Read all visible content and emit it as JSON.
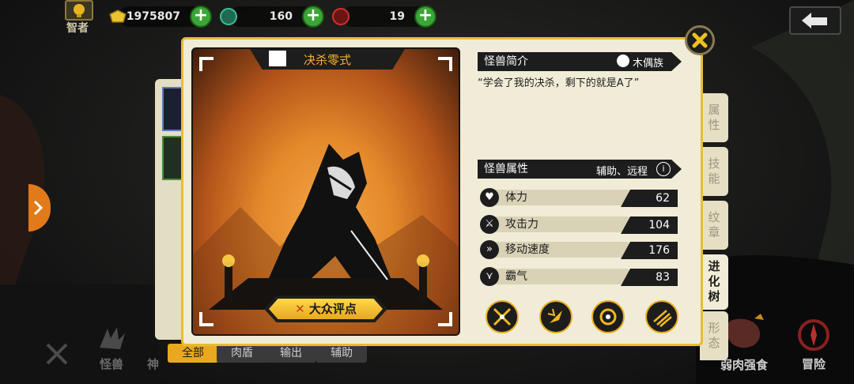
{
  "topbar": {
    "rank_label": "智者",
    "gold": "1975807",
    "green_currency": "160",
    "red_currency": "19"
  },
  "monster": {
    "name": "决杀零式",
    "intro_title": "怪兽简介",
    "race": "木偶族",
    "quote": "“学会了我的决杀，剩下的就是A了”",
    "attr_title": "怪兽属性",
    "roles": "辅助、远程",
    "rating_button": "大众评点",
    "stats": [
      {
        "label": "体力",
        "value": "62",
        "icon": "heart-icon"
      },
      {
        "label": "攻击力",
        "value": "104",
        "icon": "sword-icon"
      },
      {
        "label": "移动速度",
        "value": "176",
        "icon": "speed-icon"
      },
      {
        "label": "霸气",
        "value": "83",
        "icon": "claw-icon"
      }
    ]
  },
  "side_tabs": [
    "属性",
    "技能",
    "纹章",
    "进化树",
    "形态"
  ],
  "active_side_tab": "进化树",
  "filters": [
    "全部",
    "肉盾",
    "输出",
    "辅助"
  ],
  "active_filter": "全部",
  "bottom_nav": {
    "monster": "怪兽",
    "eat": "弱肉强食",
    "adventure": "冒险",
    "partial": "神"
  },
  "colors": {
    "accent": "#e9b320",
    "panel": "#f1ecd7",
    "dark": "#1d1d1d",
    "card_glow": "#f3a448"
  }
}
